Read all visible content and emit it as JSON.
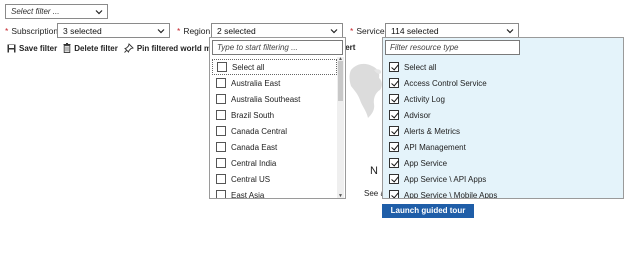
{
  "select_filter": {
    "placeholder": "Select filter ..."
  },
  "filters": {
    "subscription": {
      "label": "Subscription",
      "value": "3 selected"
    },
    "region": {
      "label": "Region",
      "value": "2 selected"
    },
    "service": {
      "label": "Service",
      "value": "114 selected"
    }
  },
  "toolbar": {
    "save": "Save filter",
    "delete": "Delete filter",
    "pin": "Pin filtered world map t",
    "alert_fragment": "lert"
  },
  "region_dropdown": {
    "search_placeholder": "Type to start filtering ...",
    "options": [
      {
        "label": "Select all",
        "checked": false
      },
      {
        "label": "Australia East",
        "checked": false
      },
      {
        "label": "Australia Southeast",
        "checked": false
      },
      {
        "label": "Brazil South",
        "checked": false
      },
      {
        "label": "Canada Central",
        "checked": false
      },
      {
        "label": "Canada East",
        "checked": false
      },
      {
        "label": "Central India",
        "checked": false
      },
      {
        "label": "Central US",
        "checked": false
      },
      {
        "label": "East Asia",
        "checked": false
      }
    ]
  },
  "service_dropdown": {
    "search_placeholder": "Filter resource type",
    "options": [
      {
        "label": "Select all",
        "checked": true
      },
      {
        "label": "Access Control Service",
        "checked": true
      },
      {
        "label": "Activity Log",
        "checked": true
      },
      {
        "label": "Advisor",
        "checked": true
      },
      {
        "label": "Alerts & Metrics",
        "checked": true
      },
      {
        "label": "API Management",
        "checked": true
      },
      {
        "label": "App Service",
        "checked": true
      },
      {
        "label": "App Service \\ API Apps",
        "checked": true
      },
      {
        "label": "App Service \\ Mobile Apps",
        "checked": true
      }
    ]
  },
  "background": {
    "heading_fragment": "N",
    "subtext_fragment": "See a",
    "launch_button": "Launch guided tour"
  },
  "colors": {
    "required": "#c4262e",
    "service_panel_bg": "#e4f3fa",
    "button_bg": "#1f5ea8"
  }
}
